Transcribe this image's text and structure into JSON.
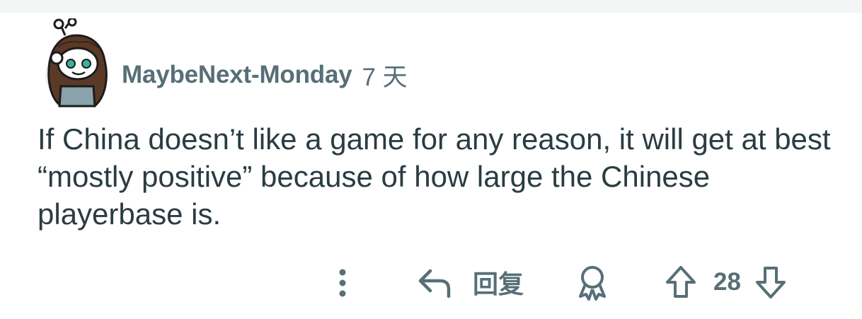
{
  "comment": {
    "author": "MaybeNext-Monday",
    "time": "7 天",
    "body": "If China doesn’t like a game for any reason, it will get at best “mostly positive” because of how large the Chinese playerbase is.",
    "score": "28"
  },
  "actions": {
    "reply_label": "回复",
    "more_icon": "more-vertical-icon",
    "reply_icon": "reply-arrow-icon",
    "award_icon": "award-icon",
    "upvote_icon": "upvote-arrow-icon",
    "downvote_icon": "downvote-arrow-icon"
  },
  "colors": {
    "meta_text": "#576f76",
    "body_text": "#2a3c42",
    "icon": "#576f76",
    "background": "#ffffff",
    "top_strip": "#f4f5f6"
  }
}
